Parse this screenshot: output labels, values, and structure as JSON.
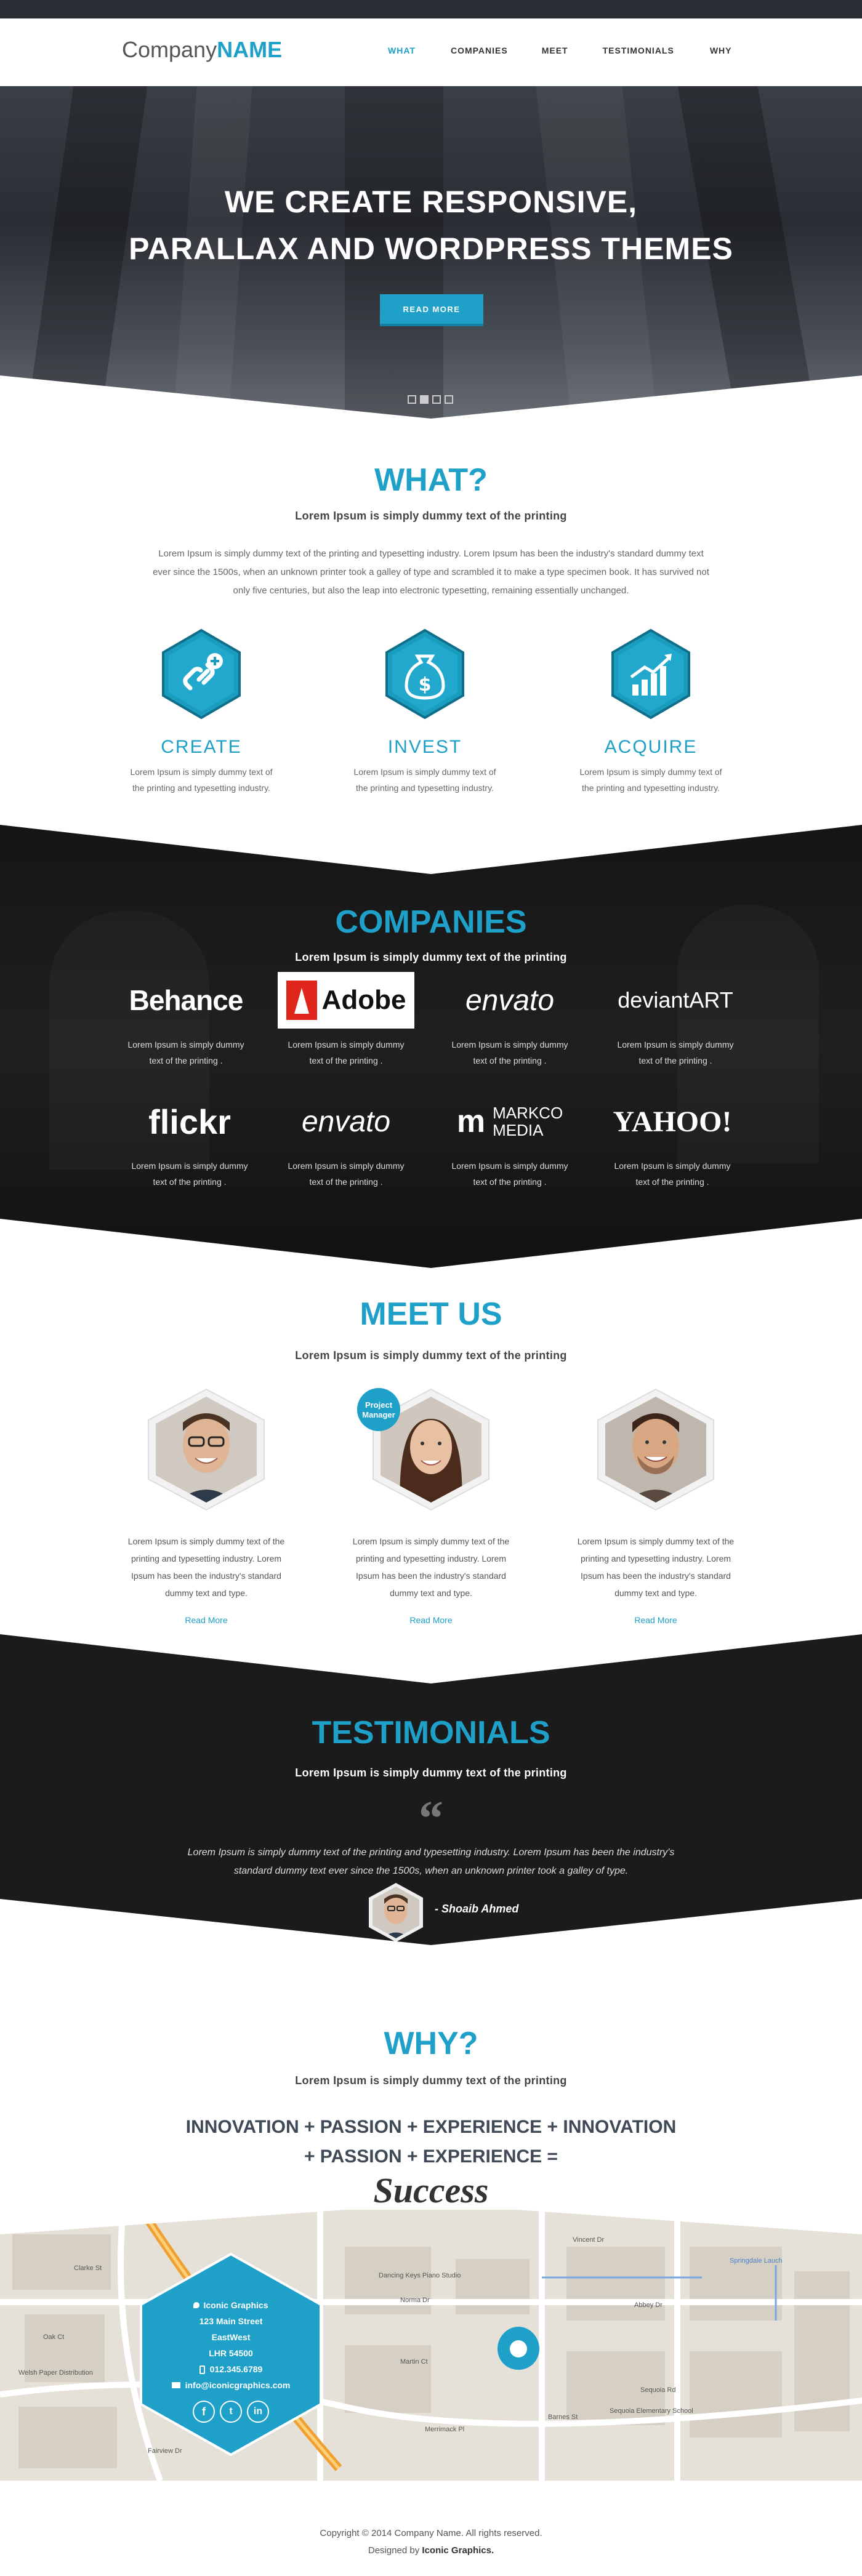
{
  "brand": {
    "logo_light": "Company",
    "logo_bold": "NAME"
  },
  "nav": {
    "items": [
      "WHAT",
      "COMPANIES",
      "MEET",
      "TESTIMONIALS",
      "WHY"
    ],
    "active": "WHAT"
  },
  "hero": {
    "line1": "WE CREATE RESPONSIVE,",
    "line2": "PARALLAX AND WORDPRESS THEMES",
    "button": "READ MORE",
    "slide_count": 4,
    "active_slide": 2
  },
  "what": {
    "title": "WHAT?",
    "subtitle": "Lorem Ipsum is simply dummy text of the printing",
    "lead_1": "Lorem Ipsum is simply dummy text of the printing and typesetting industry. Lorem Ipsum has been the industry's standard dummy text",
    "lead_2": "ever since the 1500s, when an unknown printer took a galley of type and scrambled it to make a type specimen book. It has survived not",
    "lead_3": "only five centuries, but also the leap into electronic typesetting, remaining essentially unchanged.",
    "features": [
      {
        "title": "CREATE",
        "icon": "link-plus-icon",
        "text_1": "Lorem Ipsum is simply dummy text of",
        "text_2": "the printing and typesetting industry."
      },
      {
        "title": "INVEST",
        "icon": "money-bag-icon",
        "text_1": "Lorem Ipsum is simply dummy text of",
        "text_2": "the printing and typesetting industry."
      },
      {
        "title": "ACQUIRE",
        "icon": "growth-chart-icon",
        "text_1": "Lorem Ipsum is simply dummy text of",
        "text_2": "the printing and typesetting industry."
      }
    ]
  },
  "companies": {
    "title": "COMPANIES",
    "subtitle": "Lorem Ipsum is simply dummy text of the printing",
    "logos": [
      {
        "name": "Behance",
        "text_1": "Lorem Ipsum is simply dummy",
        "text_2": "text of the printing ."
      },
      {
        "name": "Adobe",
        "text_1": "Lorem Ipsum is simply dummy",
        "text_2": "text of the printing ."
      },
      {
        "name": "envato",
        "text_1": "Lorem Ipsum is simply dummy",
        "text_2": "text of the printing ."
      },
      {
        "name": "deviantART",
        "text_1": "Lorem Ipsum is simply dummy",
        "text_2": "text of the printing ."
      },
      {
        "name": "flickr",
        "text_1": "Lorem Ipsum is simply dummy",
        "text_2": "text of the printing ."
      },
      {
        "name": "envato",
        "text_1": "Lorem Ipsum is simply dummy",
        "text_2": "text of the printing ."
      },
      {
        "name_1": "MARKCO",
        "name_2": "MEDIA",
        "text_1": "Lorem Ipsum is simply dummy",
        "text_2": "text of the printing ."
      },
      {
        "name": "YAHOO!",
        "text_1": "Lorem Ipsum is simply dummy",
        "text_2": "text of the printing ."
      }
    ]
  },
  "meet": {
    "title": "MEET US",
    "subtitle": "Lorem Ipsum is simply dummy text of the printing",
    "badge_1": "Project",
    "badge_2": "Manager",
    "people": [
      {
        "l1": "Lorem Ipsum is simply dummy text of the",
        "l2": "printing and typesetting industry. Lorem",
        "l3": "Ipsum has been the industry's standard",
        "l4": "dummy text and type.",
        "link": "Read More"
      },
      {
        "l1": "Lorem Ipsum is simply dummy text of the",
        "l2": "printing and typesetting industry. Lorem",
        "l3": "Ipsum has been the industry's standard",
        "l4": "dummy text and type.",
        "link": "Read More"
      },
      {
        "l1": "Lorem Ipsum is simply dummy text of the",
        "l2": "printing and typesetting industry. Lorem",
        "l3": "Ipsum has been the industry's standard",
        "l4": "dummy text and type.",
        "link": "Read More"
      }
    ]
  },
  "testimonials": {
    "title": "TESTIMONIALS",
    "subtitle": "Lorem Ipsum is simply dummy text of the printing",
    "quote_mark": "“",
    "quote_1": "Lorem Ipsum is simply dummy text of the printing and typesetting industry. Lorem Ipsum has been the industry's",
    "quote_2": "standard dummy text ever since the 1500s, when an unknown printer took a galley of type.",
    "author": "- Shoaib Ahmed"
  },
  "why": {
    "title": "WHY?",
    "subtitle": "Lorem Ipsum is simply dummy text of the printing",
    "line1": "INNOVATION + PASSION + EXPERIENCE + INNOVATION",
    "line2": "+ PASSION + EXPERIENCE =",
    "result": "Success"
  },
  "contact": {
    "company": "Iconic Graphics",
    "street": "123 Main Street",
    "area": "EastWest",
    "postcode": "LHR 54500",
    "phone": "012.345.6789",
    "email": "info@iconicgraphics.com",
    "social": [
      "facebook-icon",
      "twitter-icon",
      "linkedin-icon"
    ]
  },
  "map_labels": {
    "road_1": "Vincent Dr",
    "road_2": "Dancing Keys Piano Studio",
    "road_3": "Norma Dr",
    "road_4": "Abbey Dr",
    "road_5": "Springdale Lauch",
    "road_6": "Sequoia Rd",
    "road_7": "Sequoia Elementary School",
    "road_8": "Welsh Paper Distribution",
    "road_9": "Martin Ct",
    "road_10": "Merrimack Pl",
    "road_11": "Barnes St",
    "road_12": "Clarke St",
    "road_13": "Oak Ct",
    "road_14": "Fairview Dr"
  },
  "footer": {
    "copyright": "Copyright © 2014 Company Name. All rights reserved.",
    "designed_prefix": "Designed by",
    "designed_by": "Iconic Graphics."
  },
  "colors": {
    "accent": "#1ea0c8",
    "dark": "#1b1b1b"
  }
}
